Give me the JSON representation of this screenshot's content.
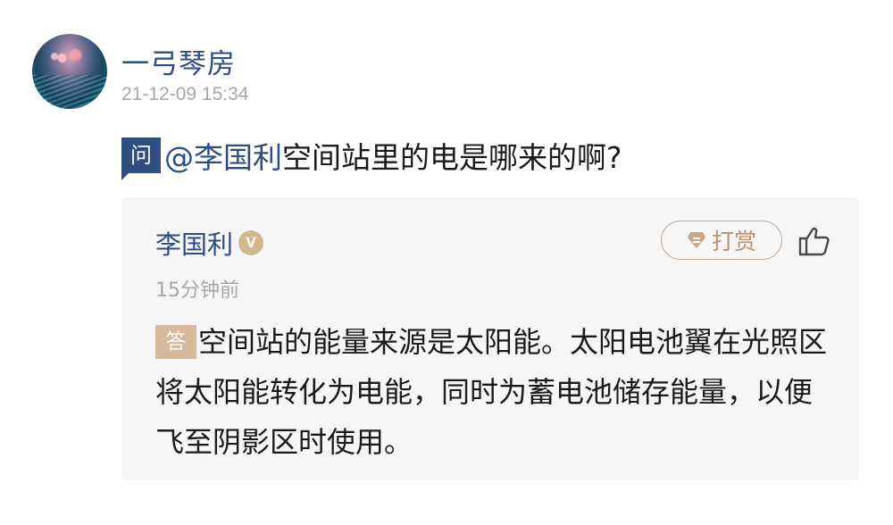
{
  "post": {
    "author": "一弓琴房",
    "timestamp": "21-12-09 15:34",
    "avatar_icon": "avatar-photo"
  },
  "question": {
    "badge": "问",
    "mention": "@李国利",
    "text": "空间站里的电是哪来的啊?"
  },
  "answer": {
    "author": "李国利",
    "verified_badge": "V",
    "time": "15分钟前",
    "tip_label": "打赏",
    "badge": "答",
    "text": "空间站的能量来源是太阳能。太阳电池翼在光照区将太阳能转化为电能，同时为蓄电池储存能量，以便飞至阴影区时使用。"
  },
  "colors": {
    "author_blue": "#2d4d82",
    "question_badge_bg": "#2f4f83",
    "answer_badge_bg": "#d8b89a",
    "tip_border": "#c6a88a",
    "meta_gray": "#a7a7a7",
    "card_bg": "#f6f6f6"
  }
}
